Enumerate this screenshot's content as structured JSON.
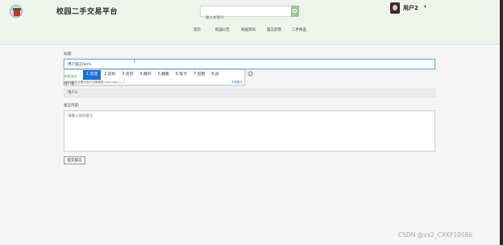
{
  "header": {
    "site_title": "校园二手交易平台",
    "search_placeholder": "输入关键词",
    "user": {
      "name": "用户2",
      "caret": "▾"
    },
    "nav": [
      "首页",
      "校园公告",
      "校园资讯",
      "留言反馈",
      "二手商品"
    ]
  },
  "form": {
    "title_label": "标题:",
    "title_value": "用户留言fan'k",
    "ime": {
      "hint": "校验测试",
      "candidates": [
        "1.反馈",
        "2.反抗",
        "3.反恐",
        "4.翻开",
        "5.翻看",
        "6.饭卡",
        "7.犯困",
        "8.返"
      ],
      "selected": 0,
      "tip": "点击前往设置页面开启模糊音<an,ang>-(...)",
      "tip_link": "不再提示"
    },
    "username_label": "用户名:",
    "username_value": "用户2",
    "content_label": "留言内容:",
    "content_placeholder": "请输入你的留言...",
    "submit_label": "提交留言"
  },
  "watermark": "CSDN @vx2_CXKF10086",
  "colors": {
    "header_bg": "#eef4ec",
    "accent": "#1f6fd6",
    "search_button": "#9bc89a"
  }
}
